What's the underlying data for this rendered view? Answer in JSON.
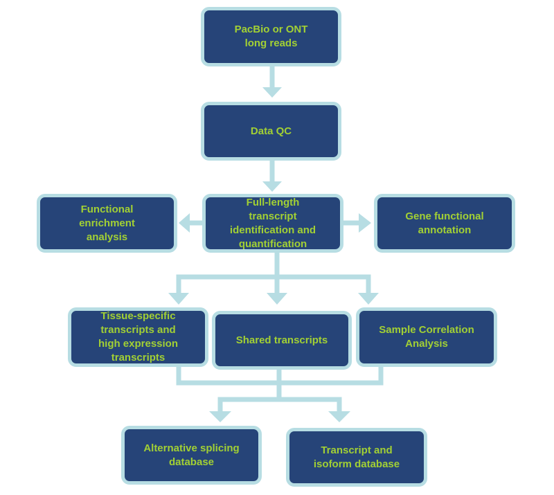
{
  "colors": {
    "box_fill": "#264478",
    "box_border": "#b7dde3",
    "text": "#a2d034",
    "connector": "#b7dde3"
  },
  "nodes": {
    "input": "PacBio or ONT\nlong reads",
    "qc": "Data QC",
    "enrichment": "Functional\nenrichment\nanalysis",
    "fulllength": "Full-length\ntranscript\nidentification and\nquantification",
    "annotation": "Gene functional\nannotation",
    "tissue": "Tissue-specific\ntranscripts and\nhigh expression\ntranscripts",
    "shared": "Shared transcripts",
    "correlation": "Sample Correlation\nAnalysis",
    "splicing": "Alternative splicing\ndatabase",
    "isoform": "Transcript and\nisoform database"
  }
}
